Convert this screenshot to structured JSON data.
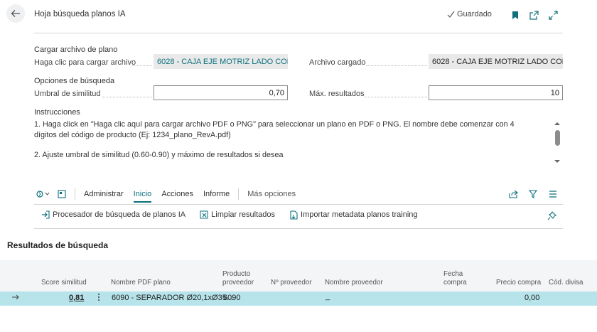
{
  "header": {
    "title": "Hoja búsqueda planos IA",
    "saved_label": "Guardado"
  },
  "upload_section": {
    "heading": "Cargar archivo de plano",
    "click_label": "Haga clic para cargar archivo",
    "click_value": "6028 - CAJA EJE MOTRIZ LADO CON...",
    "loaded_label": "Archivo cargado",
    "loaded_value": "6028 - CAJA EJE MOTRIZ LADO CON..."
  },
  "search_options": {
    "heading": "Opciones de búsqueda",
    "threshold_label": "Umbral de similitud",
    "threshold_value": "0,70",
    "max_label": "Máx. resultados",
    "max_value": "10"
  },
  "instructions": {
    "heading": "Instrucciones",
    "line1": "1. Haga click en \"Haga clic aquí para cargar archivo PDF o PNG\" para seleccionar un plano en PDF o PNG. El nombre debe comenzar con 4 dígitos del código de producto (Ej: 1234_plano_RevA.pdf)",
    "line2": "2. Ajuste umbral de similitud (0.60-0.90) y máximo de resultados si desea"
  },
  "actionbar": {
    "tabs": [
      "Administrar",
      "Inicio",
      "Acciones",
      "Informe"
    ],
    "more": "Más opciones"
  },
  "actions": {
    "process": "Procesador de búsqueda de planos IA",
    "clear": "Limpiar resultados",
    "import": "Importar metadata planos training"
  },
  "results": {
    "title": "Resultados de búsqueda",
    "columns": {
      "score": "Score similitud",
      "pdf_name": "Nombre PDF plano",
      "product": "Producto proveedor",
      "vendor_no": "Nº proveedor",
      "vendor_name": "Nombre proveedor",
      "purchase_date": "Fecha compra",
      "price": "Precio compra",
      "currency": "Cód. divisa"
    },
    "rows": [
      {
        "score": "0,81",
        "pdf_name": "6090 - SEPARADOR Ø20,1xØ35...",
        "product": "6090",
        "vendor_no": "",
        "vendor_name": "_",
        "purchase_date": "",
        "price": "0,00",
        "currency": ""
      }
    ]
  },
  "colors": {
    "accent": "#0a6f7c",
    "row_selected": "#b7e4ea"
  }
}
